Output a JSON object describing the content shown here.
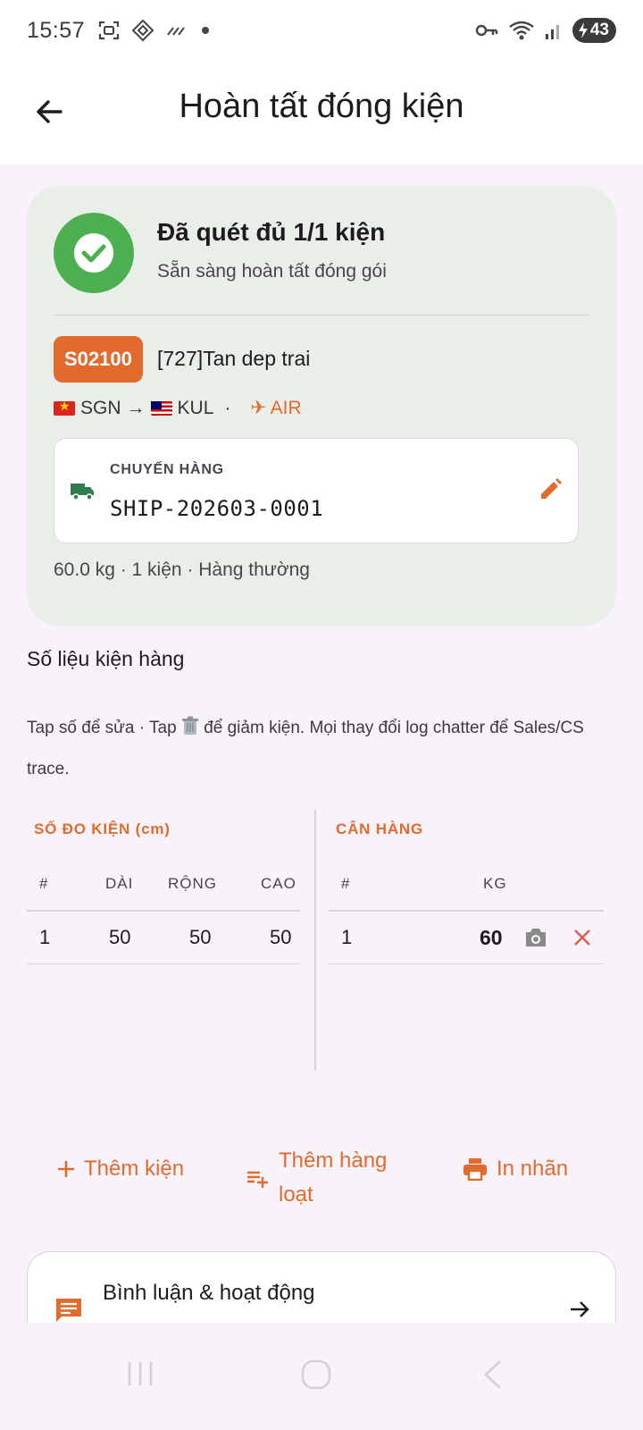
{
  "status_bar": {
    "time": "15:57",
    "battery": "43"
  },
  "appbar": {
    "title": "Hoàn tất đóng kiện"
  },
  "summary_card": {
    "headline": "Đã quét đủ 1/1 kiện",
    "subline": "Sẵn sàng hoàn tất đóng gói",
    "order_code": "S02100",
    "customer": "[727]Tan dep trai",
    "route_from": "SGN",
    "route_arrow": "→",
    "route_to": "KUL",
    "route_sep": "·",
    "mode": "✈ AIR",
    "shipment_label": "CHUYẾN HÀNG",
    "shipment_value": "SHIP-202603-0001",
    "totals": "60.0 kg · 1 kiện · Hàng thường"
  },
  "package_section": {
    "title": "Số liệu kiện hàng",
    "hint_part1": "Tap số để sửa · Tap ",
    "hint_part2": " để giảm kiện. Mọi thay đổi log chatter để Sales/CS trace.",
    "dimensions": {
      "heading": "SỐ ĐO KIỆN (cm)",
      "columns": [
        "#",
        "DÀI",
        "RỘNG",
        "CAO"
      ],
      "rows": [
        [
          "1",
          "50",
          "50",
          "50"
        ]
      ]
    },
    "weight": {
      "heading": "CÂN HÀNG",
      "columns": [
        "#",
        "KG"
      ],
      "rows": [
        [
          "1",
          "60"
        ]
      ]
    }
  },
  "actions": {
    "add_package": "Thêm kiện",
    "add_bulk": "Thêm hàng loạt",
    "print_label": "In nhãn"
  },
  "comments": {
    "title": "Bình luận & hoạt động"
  },
  "colors": {
    "accent": "#e26a2c",
    "success": "#4caf50",
    "card_bg": "#e9efe8",
    "page_bg": "#f8f2fa"
  }
}
